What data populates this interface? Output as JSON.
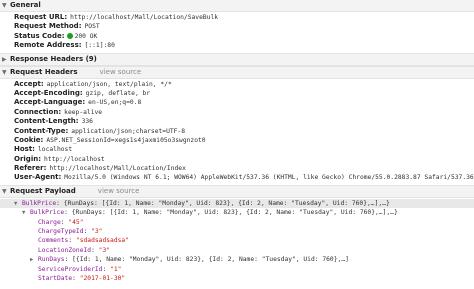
{
  "general": {
    "header": "General",
    "rows": [
      {
        "key": "Request URL:",
        "value": "http://localhost/Mall/Location/SaveBulk"
      },
      {
        "key": "Request Method:",
        "value": "POST"
      },
      {
        "key": "Status Code:",
        "value": "200 OK"
      },
      {
        "key": "Remote Address:",
        "value": "[::1]:80"
      }
    ]
  },
  "response_headers": {
    "header": "Response Headers (9)"
  },
  "request_headers": {
    "header": "Request Headers",
    "view_source": "view source",
    "rows": [
      {
        "key": "Accept:",
        "value": "application/json, text/plain, */*"
      },
      {
        "key": "Accept-Encoding:",
        "value": "gzip, deflate, br"
      },
      {
        "key": "Accept-Language:",
        "value": "en-US,en;q=0.8"
      },
      {
        "key": "Connection:",
        "value": "keep-alive"
      },
      {
        "key": "Content-Length:",
        "value": "336"
      },
      {
        "key": "Content-Type:",
        "value": "application/json;charset=UTF-8"
      },
      {
        "key": "Cookie:",
        "value": "ASP.NET_SessionId=xegs1s4jaxmi05o3swgnzot0"
      },
      {
        "key": "Host:",
        "value": "localhost"
      },
      {
        "key": "Origin:",
        "value": "http://localhost"
      },
      {
        "key": "Referer:",
        "value": "http://localhost/Mall/Location/Index"
      },
      {
        "key": "User-Agent:",
        "value": "Mozilla/5.0 (Windows NT 6.1; WOW64) AppleWebKit/537.36 (KHTML, like Gecko) Chrome/55.0.2883.87 Safari/537.36"
      }
    ]
  },
  "request_payload": {
    "header": "Request Payload",
    "view_source": "view source",
    "lines": {
      "root_key": "BulkPrice",
      "root_value": "{RunDays: [{Id: 1, Name: \"Monday\", Uid: 823}, {Id: 2, Name: \"Tuesday\", Uid: 760},…],…}",
      "child_key": "BulkPrice",
      "child_value": "{RunDays: [{Id: 1, Name: \"Monday\", Uid: 823}, {Id: 2, Name: \"Tuesday\", Uid: 760},…],…}",
      "charge_key": "Charge",
      "charge_value": "\"45\"",
      "chargetype_key": "ChargeTypeId",
      "chargetype_value": "\"3\"",
      "comments_key": "Comments",
      "comments_value": "\"sdadsadsadsa\"",
      "locationzone_key": "LocationZoneId",
      "locationzone_value": "\"3\"",
      "rundays_key": "RunDays",
      "rundays_value": "[{Id: 1, Name: \"Monday\", Uid: 823}, {Id: 2, Name: \"Tuesday\", Uid: 760},…]",
      "serviceprovider_key": "ServiceProviderId",
      "serviceprovider_value": "\"1\"",
      "startdate_key": "StartDate",
      "startdate_value": "\"2017-01-30\""
    }
  },
  "icons": {
    "expanded": "triangle-down-icon",
    "collapsed": "triangle-right-icon",
    "status": "status-dot-icon"
  },
  "colors": {
    "status_ok": "#19a319",
    "payload_key": "#8c1b95",
    "payload_string": "#c41a16"
  }
}
